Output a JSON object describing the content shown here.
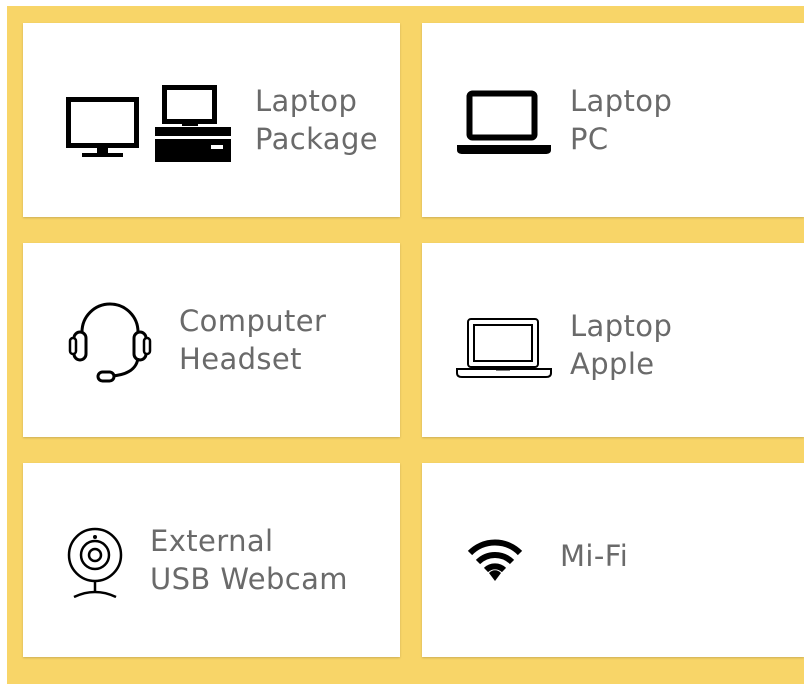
{
  "items": [
    {
      "line1": "Laptop",
      "line2": "Package",
      "icon": "monitor-and-desktop-icon"
    },
    {
      "line1": "Laptop",
      "line2": "PC",
      "icon": "laptop-icon"
    },
    {
      "line1": "Computer",
      "line2": "Headset",
      "icon": "headset-icon"
    },
    {
      "line1": "Laptop",
      "line2": "Apple",
      "icon": "laptop-outline-icon"
    },
    {
      "line1": "External",
      "line2": "USB Webcam",
      "icon": "webcam-icon"
    },
    {
      "line1": "Mi-Fi",
      "line2": "",
      "icon": "wifi-icon"
    }
  ],
  "colors": {
    "background": "#f8d568",
    "card": "#ffffff",
    "text": "#6a6a6a",
    "icon": "#000000"
  }
}
